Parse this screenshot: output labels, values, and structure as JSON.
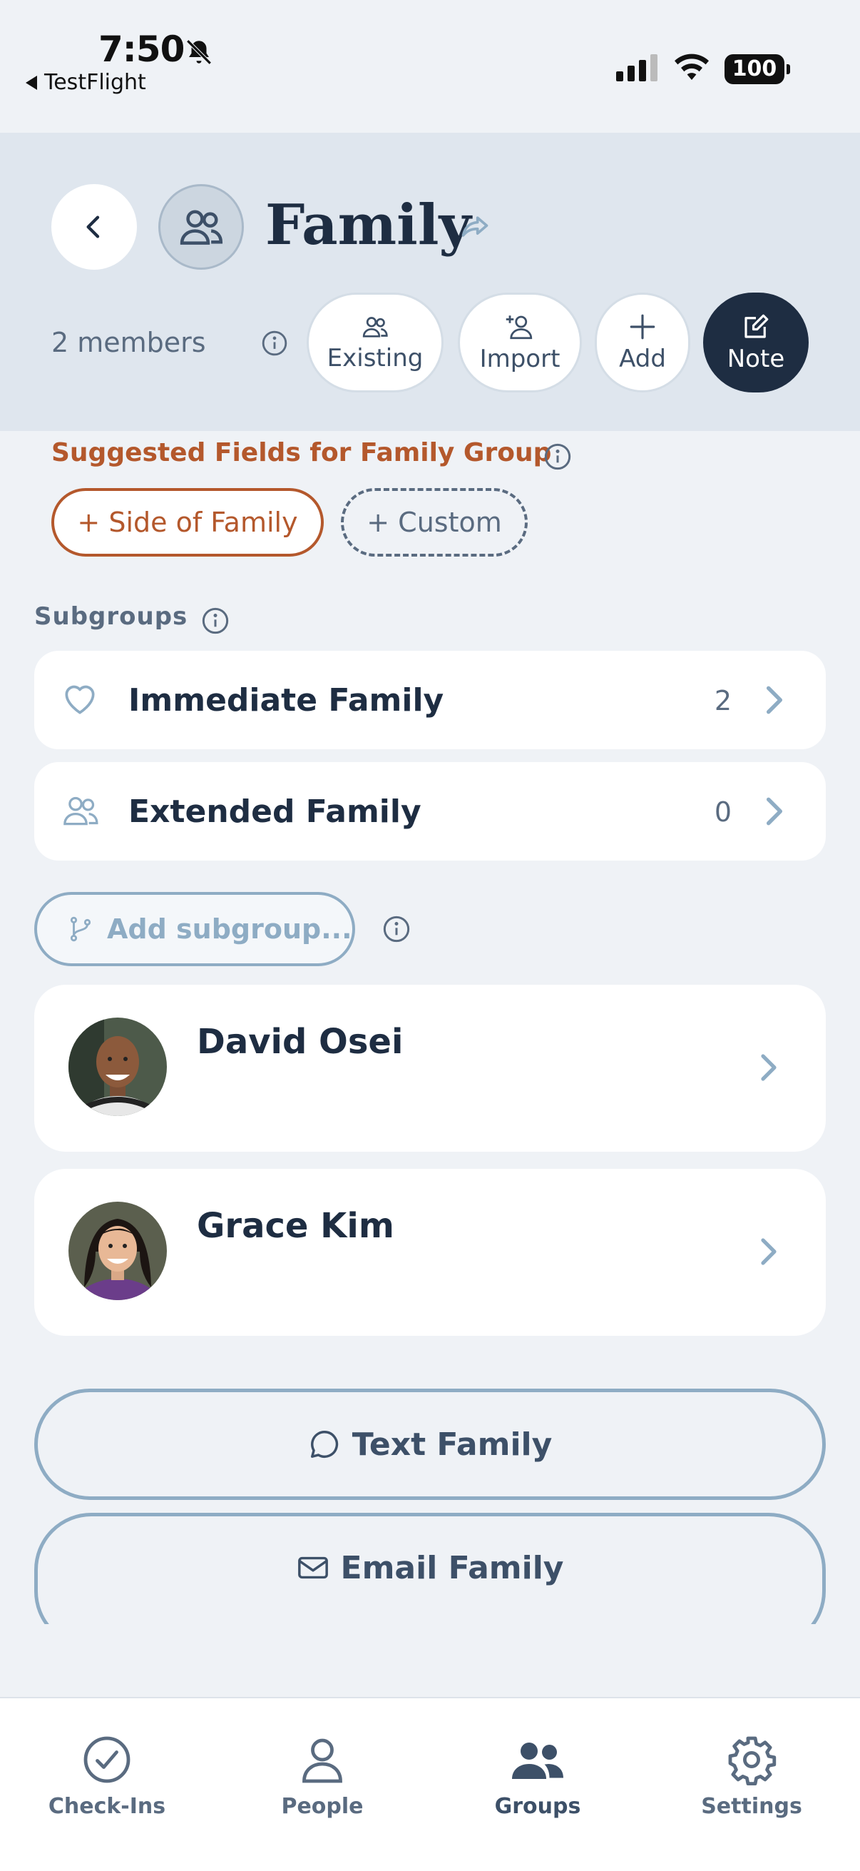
{
  "status_bar": {
    "time": "7:50",
    "back_app": "TestFlight",
    "battery": "100"
  },
  "header": {
    "title": "Family",
    "members": "2 members",
    "actions": [
      {
        "label": "Existing",
        "icon": "people-icon"
      },
      {
        "label": "Import",
        "icon": "add-person-icon"
      },
      {
        "label": "Add",
        "icon": "plus-icon"
      },
      {
        "label": "Note",
        "icon": "edit-note-icon"
      }
    ]
  },
  "suggested": {
    "title": "Suggested Fields for Family Group",
    "chips": [
      "+ Side of Family",
      "+ Custom"
    ]
  },
  "subgroups": {
    "title": "Subgroups",
    "items": [
      {
        "name": "Immediate Family",
        "count": "2",
        "icon": "heart-icon"
      },
      {
        "name": "Extended Family",
        "count": "0",
        "icon": "people-icon"
      }
    ],
    "add_label": "Add subgroup..."
  },
  "people": [
    {
      "name": "David Osei"
    },
    {
      "name": "Grace Kim"
    }
  ],
  "buttons": {
    "text": "Text Family",
    "email": "Email Family"
  },
  "tabs": [
    {
      "label": "Check-Ins",
      "icon": "check-circle-icon"
    },
    {
      "label": "People",
      "icon": "person-icon"
    },
    {
      "label": "Groups",
      "icon": "groups-icon",
      "active": true
    },
    {
      "label": "Settings",
      "icon": "gear-icon"
    }
  ],
  "colors": {
    "accent_orange": "#b4582c",
    "navy": "#1e2d42",
    "slate_blue": "#8eacc4",
    "header_bg": "#dfe6ee"
  }
}
